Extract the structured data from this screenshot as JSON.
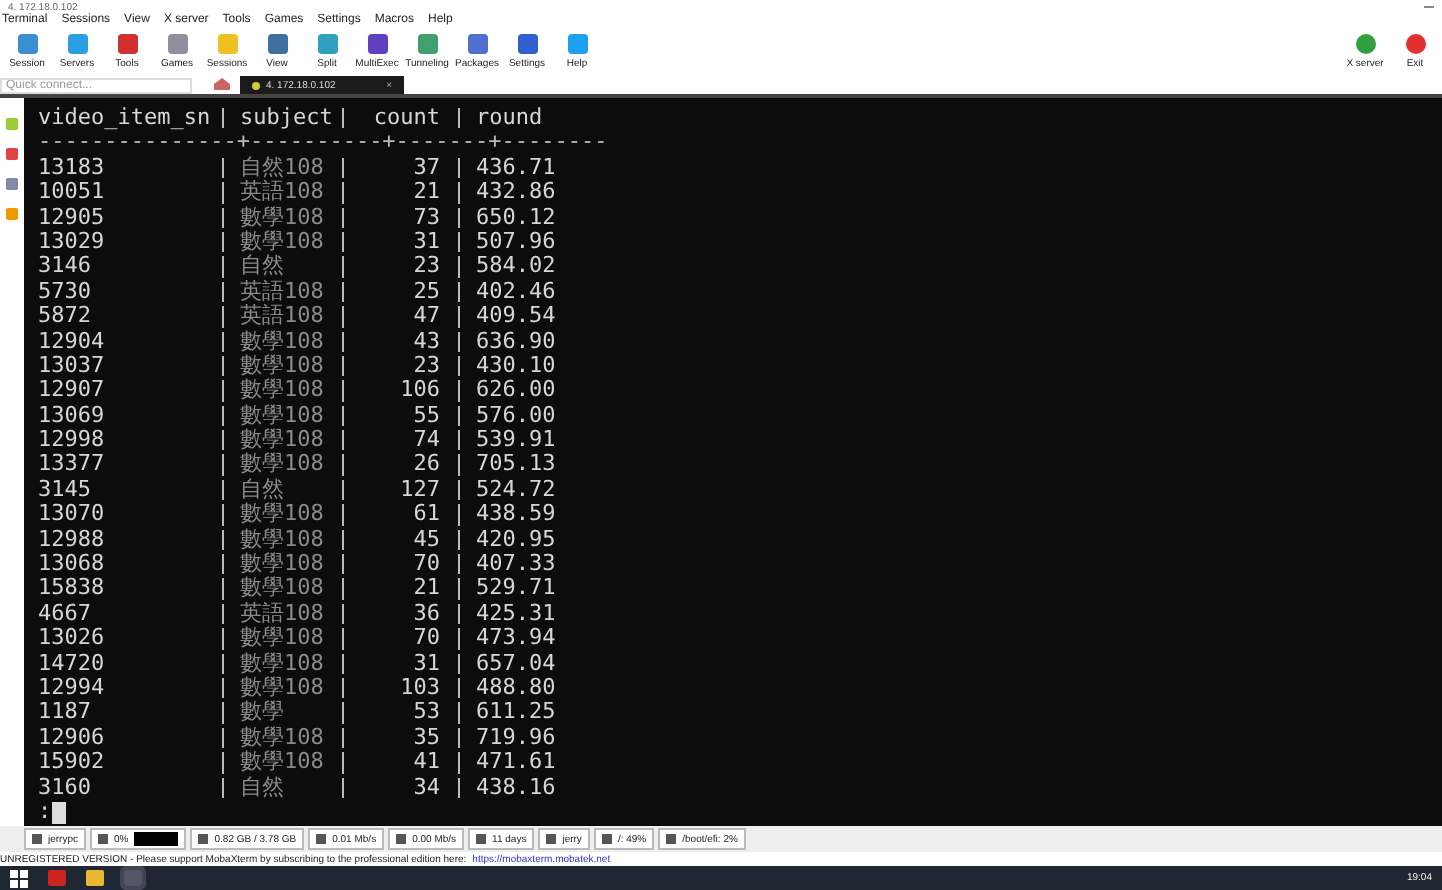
{
  "window": {
    "title": "4. 172.18.0.102"
  },
  "menu": [
    "Terminal",
    "Sessions",
    "View",
    "X server",
    "Tools",
    "Games",
    "Settings",
    "Macros",
    "Help"
  ],
  "toolbar": [
    {
      "label": "Session",
      "color": "#3a8fd0"
    },
    {
      "label": "Servers",
      "color": "#2aa0e0"
    },
    {
      "label": "Tools",
      "color": "#d03030"
    },
    {
      "label": "Games",
      "color": "#9090a0"
    },
    {
      "label": "Sessions",
      "color": "#f0c020"
    },
    {
      "label": "View",
      "color": "#4070a0"
    },
    {
      "label": "Split",
      "color": "#30a0c0"
    },
    {
      "label": "MultiExec",
      "color": "#6040c0"
    },
    {
      "label": "Tunneling",
      "color": "#40a070"
    },
    {
      "label": "Packages",
      "color": "#5070d0"
    },
    {
      "label": "Settings",
      "color": "#3060d0"
    },
    {
      "label": "Help",
      "color": "#20a0f0"
    }
  ],
  "toolbar_right": [
    {
      "label": "X server",
      "color": "#30a040"
    },
    {
      "label": "Exit",
      "color": "#e03030"
    }
  ],
  "quick_connect": {
    "placeholder": "Quick connect..."
  },
  "tabs": [
    {
      "label": "4. 172.18.0.102",
      "selected": true,
      "close": "×"
    }
  ],
  "terminal": {
    "columns": [
      "video_item_sn",
      "subject",
      "count",
      "round"
    ],
    "separator": "---------------+----------+-------+--------",
    "rows": [
      [
        "13183",
        "自然108",
        "37",
        "436.71"
      ],
      [
        "10051",
        "英語108",
        "21",
        "432.86"
      ],
      [
        "12905",
        "數學108",
        "73",
        "650.12"
      ],
      [
        "13029",
        "數學108",
        "31",
        "507.96"
      ],
      [
        "3146",
        "自然",
        "23",
        "584.02"
      ],
      [
        "5730",
        "英語108",
        "25",
        "402.46"
      ],
      [
        "5872",
        "英語108",
        "47",
        "409.54"
      ],
      [
        "12904",
        "數學108",
        "43",
        "636.90"
      ],
      [
        "13037",
        "數學108",
        "23",
        "430.10"
      ],
      [
        "12907",
        "數學108",
        "106",
        "626.00"
      ],
      [
        "13069",
        "數學108",
        "55",
        "576.00"
      ],
      [
        "12998",
        "數學108",
        "74",
        "539.91"
      ],
      [
        "13377",
        "數學108",
        "26",
        "705.13"
      ],
      [
        "3145",
        "自然",
        "127",
        "524.72"
      ],
      [
        "13070",
        "數學108",
        "61",
        "438.59"
      ],
      [
        "12988",
        "數學108",
        "45",
        "420.95"
      ],
      [
        "13068",
        "數學108",
        "70",
        "407.33"
      ],
      [
        "15838",
        "數學108",
        "21",
        "529.71"
      ],
      [
        "4667",
        "英語108",
        "36",
        "425.31"
      ],
      [
        "13026",
        "數學108",
        "70",
        "473.94"
      ],
      [
        "14720",
        "數學108",
        "31",
        "657.04"
      ],
      [
        "12994",
        "數學108",
        "103",
        "488.80"
      ],
      [
        "1187",
        "數學",
        "53",
        "611.25"
      ],
      [
        "12906",
        "數學108",
        "35",
        "719.96"
      ],
      [
        "15902",
        "數學108",
        "41",
        "471.61"
      ],
      [
        "3160",
        "自然",
        "34",
        "438.16"
      ]
    ],
    "prompt": ":"
  },
  "status_bar": [
    "jerrypc",
    "0%",
    "0.82 GB / 3.78 GB",
    "0.01 Mb/s",
    "0.00 Mb/s",
    "11 days",
    "jerry",
    "/: 49%",
    "/boot/efi: 2%"
  ],
  "notice": {
    "text": "UNREGISTERED VERSION  -  Please support MobaXterm by subscribing to the professional edition here:",
    "link": "https://mobaxterm.mobatek.net"
  },
  "taskbar": {
    "clock": "19:04"
  }
}
